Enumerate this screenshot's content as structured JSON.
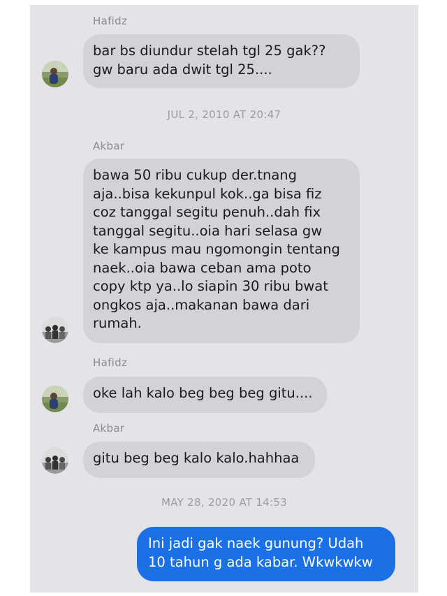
{
  "conversation": [
    {
      "type": "sender",
      "name": "Hafidz"
    },
    {
      "type": "incoming",
      "from": "Hafidz",
      "lines": [
        "bar bs diundur stelah tgl 25 gak??",
        "gw baru ada dwit tgl 25...."
      ]
    },
    {
      "type": "timestamp",
      "text": "JUL 2, 2010 AT 20:47"
    },
    {
      "type": "sender",
      "name": "Akbar"
    },
    {
      "type": "incoming",
      "from": "Akbar",
      "lines": [
        "bawa 50 ribu cukup der.tnang",
        "aja..bisa kekunpul kok..ga bisa fiz",
        "coz tanggal segitu penuh..dah fix",
        "tanggal segitu..oia hari selasa gw",
        "ke kampus mau ngomongin tentang",
        "naek..oia bawa ceban ama poto",
        "copy ktp ya..lo siapin 30 ribu bwat",
        "ongkos aja..makanan bawa dari",
        "rumah."
      ]
    },
    {
      "type": "sender",
      "name": "Hafidz"
    },
    {
      "type": "incoming",
      "from": "Hafidz",
      "lines": [
        "oke lah kalo beg beg beg gitu...."
      ]
    },
    {
      "type": "sender",
      "name": "Akbar"
    },
    {
      "type": "incoming",
      "from": "Akbar",
      "lines": [
        "gitu beg beg kalo kalo.hahhaa"
      ]
    },
    {
      "type": "timestamp",
      "text": "MAY 28, 2020 AT 14:53"
    },
    {
      "type": "outgoing",
      "lines": [
        "Ini jadi gak naek gunung? Udah",
        "10 tahun g ada kabar. Wkwkwkw"
      ]
    }
  ],
  "colors": {
    "background": "#e3e3e8",
    "incoming_bubble": "#d2d2d7",
    "outgoing_bubble": "#1b70e6",
    "meta_text": "#8a8a90"
  }
}
